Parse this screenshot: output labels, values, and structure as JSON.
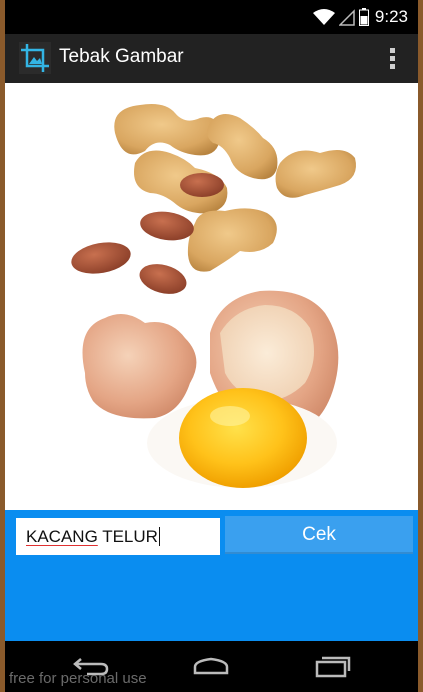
{
  "status_bar": {
    "time": "9:23"
  },
  "action_bar": {
    "title": "Tebak Gambar"
  },
  "picture": {
    "subject": "peanuts and cracked egg"
  },
  "answer": {
    "value_word1": "KACANG",
    "value_word2": " TELUR",
    "button_label": "Cek"
  },
  "watermark": "free for personal use",
  "colors": {
    "answer_area": "#0a8df0",
    "button": "#3aa0ef",
    "action_bar": "#222222"
  }
}
